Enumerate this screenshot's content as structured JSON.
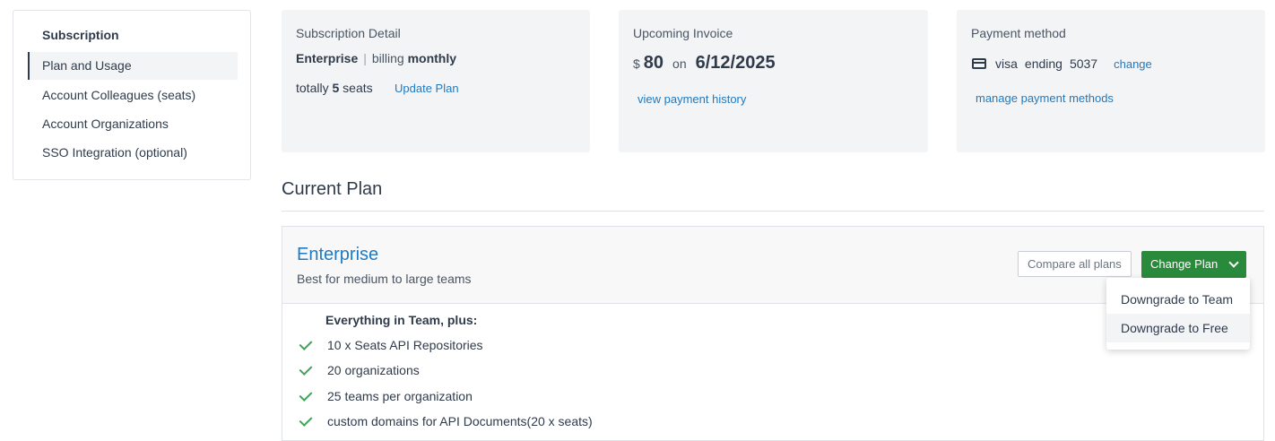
{
  "sidebar": {
    "title": "Subscription",
    "items": [
      {
        "label": "Plan and Usage",
        "active": true
      },
      {
        "label": "Account Colleagues (seats)"
      },
      {
        "label": "Account Organizations"
      },
      {
        "label": "SSO Integration (optional)"
      }
    ]
  },
  "subscription_detail": {
    "title": "Subscription Detail",
    "plan": "Enterprise",
    "separator": "|",
    "billing_label": "billing",
    "billing_period": "monthly",
    "seats_prefix": "totally",
    "seats_count": "5",
    "seats_suffix": "seats",
    "update_link": "Update Plan"
  },
  "upcoming_invoice": {
    "title": "Upcoming Invoice",
    "currency": "$",
    "amount": "80",
    "on_label": "on",
    "date": "6/12/2025",
    "history_link": "view payment history"
  },
  "payment_method": {
    "title": "Payment method",
    "icon": "credit-card-icon",
    "brand": "visa",
    "ending_label": "ending",
    "last4": "5037",
    "change_link": "change",
    "manage_link": "manage payment methods"
  },
  "current_plan": {
    "section_title": "Current Plan",
    "name": "Enterprise",
    "description": "Best for medium to large teams",
    "compare_button": "Compare all plans",
    "change_button": "Change Plan",
    "features_header": "Everything in Team, plus:",
    "features": [
      "10 x Seats API Repositories",
      "20 organizations",
      "25 teams per organization",
      "custom domains for API Documents(20 x seats)"
    ]
  },
  "change_plan_menu": {
    "items": [
      "Downgrade to Team",
      "Downgrade to Free"
    ]
  },
  "colors": {
    "accent_link": "#1f7ac2",
    "primary_button": "#2a8a3c",
    "check": "#3ea356",
    "card_bg": "#f3f4f6"
  }
}
